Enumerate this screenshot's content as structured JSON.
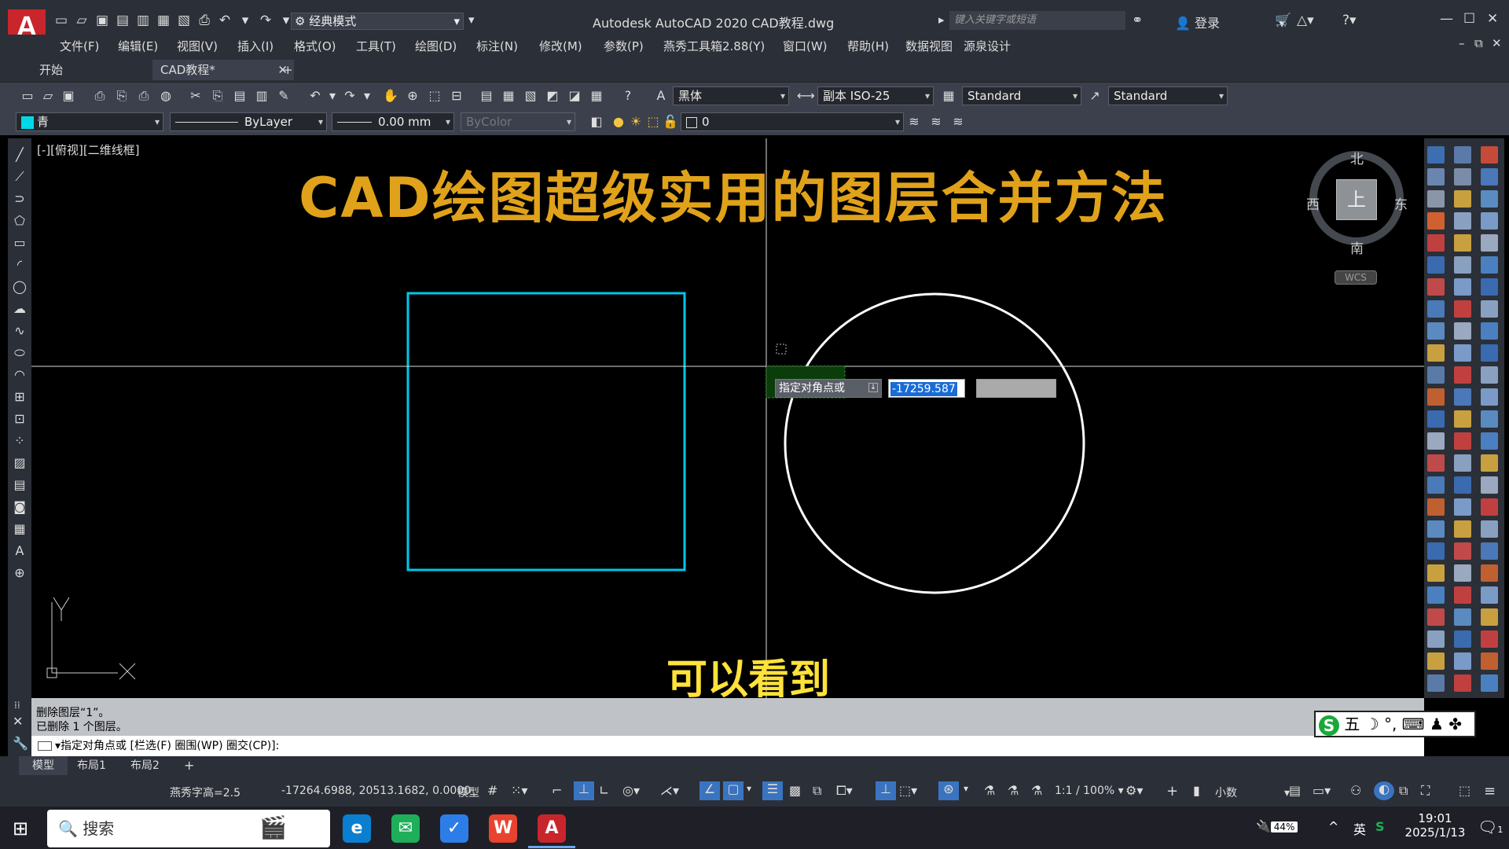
{
  "app": {
    "title": "Autodesk AutoCAD 2020    CAD教程.dwg",
    "workspace": "经典模式",
    "search_placeholder": "键入关键字或短语",
    "login": "登录"
  },
  "menu": [
    "文件(F)",
    "编辑(E)",
    "视图(V)",
    "插入(I)",
    "格式(O)",
    "工具(T)",
    "绘图(D)",
    "标注(N)",
    "修改(M)",
    "参数(P)",
    "燕秀工具箱2.88(Y)",
    "窗口(W)",
    "帮助(H)",
    "数据视图",
    "源泉设计"
  ],
  "tabs": {
    "start": "开始",
    "doc": "CAD教程*",
    "close": "✕",
    "add": "+"
  },
  "toolbar": {
    "font": "黑体",
    "dimstyle": "副本 ISO-25",
    "textstyle": "Standard",
    "tablestyle": "Standard"
  },
  "props": {
    "color": "青",
    "linetype": "ByLayer",
    "lineweight": "0.00 mm",
    "plotstyle": "ByColor",
    "layer": "0"
  },
  "viewport": {
    "label": "[-][俯视][二维线框]",
    "video_title": "CAD绘图超级实用的图层合并方法",
    "subtitle": "可以看到"
  },
  "compass": {
    "north": "北",
    "south": "南",
    "east": "东",
    "west": "西",
    "top": "上",
    "wcs": "WCS"
  },
  "tooltip": {
    "prompt": "指定对角点或",
    "value": "-17259.587"
  },
  "ucs": {
    "x": "X",
    "y": "Y"
  },
  "command": {
    "history1": "删除图层“1”。",
    "history2": "已删除 1 个图层。",
    "prompt": "指定对角点或 [栏选(F) 圈围(WP) 圈交(CP)]:"
  },
  "layout_tabs": [
    "模型",
    "布局1",
    "布局2"
  ],
  "status": {
    "textheight": "燕秀字高=2.5",
    "coords": "-17264.6988, 20513.1682, 0.0000",
    "model": "模型",
    "scale": "1:1 / 100%",
    "units": "小数"
  },
  "ime": {
    "text": "五"
  },
  "taskbar": {
    "search": "搜索",
    "battery": "44%",
    "lang": "英",
    "time": "19:01",
    "date": "2025/1/13",
    "notifications": "1"
  },
  "colors": {
    "accent": "#c9252c",
    "rect": "#00c8e8",
    "title": "#e0a21b",
    "subtitle": "#ffe23a"
  }
}
